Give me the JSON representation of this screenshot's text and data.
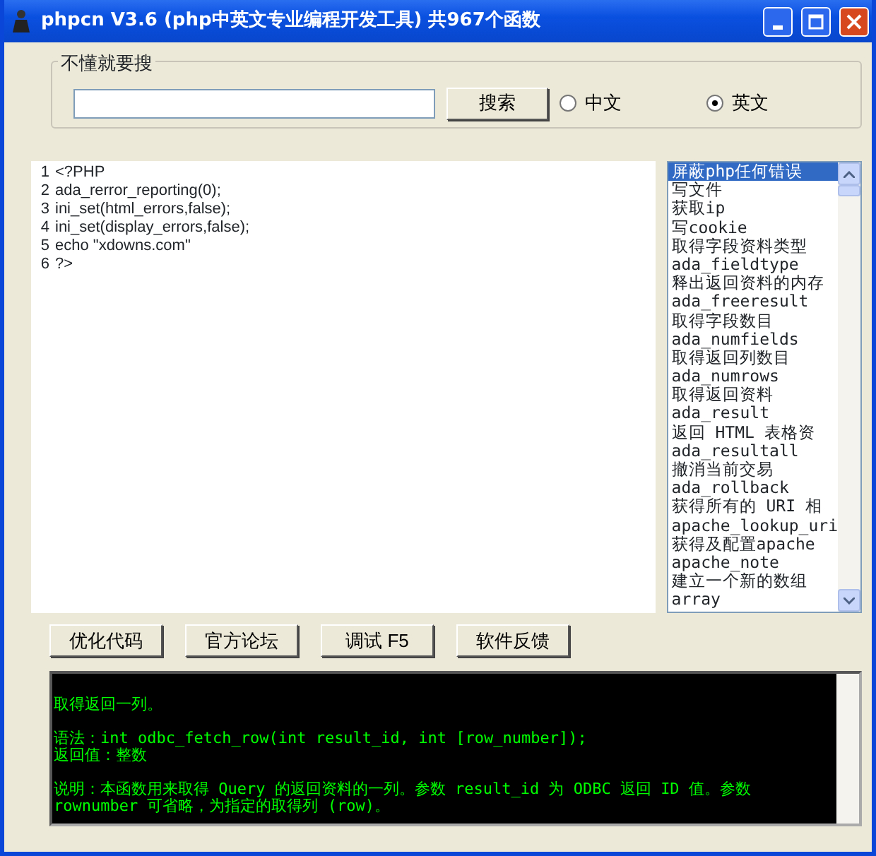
{
  "window": {
    "title": "phpcn V3.6 (php中英文专业编程开发工具) 共967个函数"
  },
  "search": {
    "group_label": "不懂就要搜",
    "button": "搜索",
    "languages": [
      {
        "label": "中文",
        "selected": false
      },
      {
        "label": "英文",
        "selected": true
      }
    ]
  },
  "editor": {
    "lines": [
      {
        "number": "1",
        "code": "<?PHP"
      },
      {
        "number": "2",
        "code": "ada_rerror_reporting(0);"
      },
      {
        "number": "3",
        "code": "ini_set(html_errors,false);"
      },
      {
        "number": "4",
        "code": "ini_set(display_errors,false);"
      },
      {
        "number": "5",
        "code": "echo \"xdowns.com\""
      },
      {
        "number": "6",
        "code": "?>"
      }
    ]
  },
  "function_list": {
    "items": [
      {
        "label": "屏蔽php任何错误",
        "selected": true
      },
      {
        "label": "写文件",
        "selected": false
      },
      {
        "label": "获取ip",
        "selected": false
      },
      {
        "label": "写cookie",
        "selected": false
      },
      {
        "label": "取得字段资料类型",
        "selected": false
      },
      {
        "label": "ada_fieldtype",
        "selected": false
      },
      {
        "label": "释出返回资料的内存",
        "selected": false
      },
      {
        "label": "ada_freeresult",
        "selected": false
      },
      {
        "label": "取得字段数目",
        "selected": false
      },
      {
        "label": "ada_numfields",
        "selected": false
      },
      {
        "label": "取得返回列数目",
        "selected": false
      },
      {
        "label": "ada_numrows",
        "selected": false
      },
      {
        "label": "取得返回资料",
        "selected": false
      },
      {
        "label": "ada_result",
        "selected": false
      },
      {
        "label": "返回 HTML 表格资",
        "selected": false
      },
      {
        "label": "ada_resultall",
        "selected": false
      },
      {
        "label": "撤消当前交易",
        "selected": false
      },
      {
        "label": "ada_rollback",
        "selected": false
      },
      {
        "label": "获得所有的 URI 相",
        "selected": false
      },
      {
        "label": "apache_lookup_uri",
        "selected": false
      },
      {
        "label": "获得及配置apache",
        "selected": false
      },
      {
        "label": "apache_note",
        "selected": false
      },
      {
        "label": "建立一个新的数组",
        "selected": false
      },
      {
        "label": "array",
        "selected": false
      }
    ]
  },
  "buttons": [
    "优化代码",
    "官方论坛",
    "调试 F5",
    "软件反馈"
  ],
  "output": {
    "paragraphs": [
      [
        "取得返回一列。"
      ],
      [
        "语法：int odbc_fetch_row(int result_id, int [row_number]);",
        "返回值：整数"
      ],
      [
        "说明：本函数用来取得 Query 的返回资料的一列。参数 result_id 为 ODBC 返回 ID 值。参数 rownumber 可省略，为指定的取得列 (row)。"
      ]
    ]
  }
}
